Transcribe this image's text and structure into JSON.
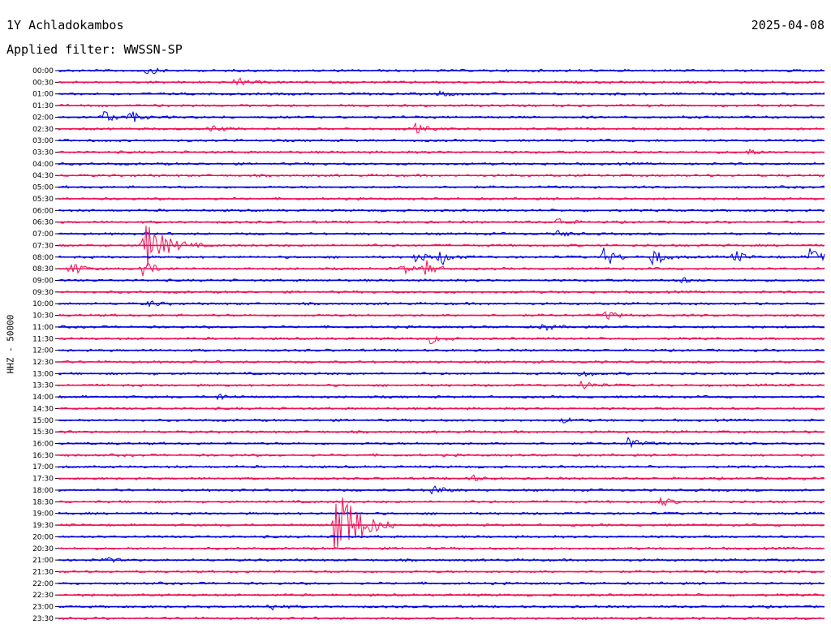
{
  "header": {
    "station": "1Y Achladokambos",
    "date": "2025-04-08",
    "filter": "Applied filter: WWSSN-SP"
  },
  "chart_data": {
    "type": "line",
    "plot_kind": "helicorder",
    "ylabel": "HHZ - 50000",
    "colors": [
      "#0000dd",
      "#ee1155"
    ],
    "rows": [
      "00:00",
      "00:30",
      "01:00",
      "01:30",
      "02:00",
      "02:30",
      "03:00",
      "03:30",
      "04:00",
      "04:30",
      "05:00",
      "05:30",
      "06:00",
      "06:30",
      "07:00",
      "07:30",
      "08:00",
      "08:30",
      "09:00",
      "09:30",
      "10:00",
      "10:30",
      "11:00",
      "11:30",
      "12:00",
      "12:30",
      "13:00",
      "13:30",
      "14:00",
      "14:30",
      "15:00",
      "15:30",
      "16:00",
      "16:30",
      "17:00",
      "17:30",
      "18:00",
      "18:30",
      "19:00",
      "19:30",
      "20:00",
      "20:30",
      "21:00",
      "21:30",
      "22:00",
      "22:30",
      "23:00",
      "23:30"
    ],
    "x_range_minutes": [
      0,
      30
    ],
    "events": [
      {
        "row": "00:00",
        "minute": 3.5,
        "amplitude": 5
      },
      {
        "row": "00:30",
        "minute": 7.0,
        "amplitude": 6
      },
      {
        "row": "01:00",
        "minute": 15.0,
        "amplitude": 4
      },
      {
        "row": "02:00",
        "minute": 1.8,
        "amplitude": 8
      },
      {
        "row": "02:00",
        "minute": 2.8,
        "amplitude": 8
      },
      {
        "row": "02:30",
        "minute": 6.0,
        "amplitude": 5
      },
      {
        "row": "02:30",
        "minute": 14.0,
        "amplitude": 6
      },
      {
        "row": "03:30",
        "minute": 27.0,
        "amplitude": 4
      },
      {
        "row": "06:30",
        "minute": 19.6,
        "amplitude": 6
      },
      {
        "row": "07:00",
        "minute": 19.6,
        "amplitude": 4
      },
      {
        "row": "07:30",
        "minute": 3.4,
        "amplitude": 30
      },
      {
        "row": "08:00",
        "minute": 14.0,
        "amplitude": 8
      },
      {
        "row": "08:00",
        "minute": 15.0,
        "amplitude": 10
      },
      {
        "row": "08:00",
        "minute": 21.4,
        "amplitude": 14
      },
      {
        "row": "08:00",
        "minute": 23.3,
        "amplitude": 12
      },
      {
        "row": "08:00",
        "minute": 26.5,
        "amplitude": 8
      },
      {
        "row": "08:00",
        "minute": 29.5,
        "amplitude": 16
      },
      {
        "row": "08:30",
        "minute": 0.5,
        "amplitude": 10
      },
      {
        "row": "08:30",
        "minute": 3.3,
        "amplitude": 14
      },
      {
        "row": "08:30",
        "minute": 13.5,
        "amplitude": 6
      },
      {
        "row": "08:30",
        "minute": 14.4,
        "amplitude": 10
      },
      {
        "row": "09:00",
        "minute": 24.3,
        "amplitude": 5
      },
      {
        "row": "10:00",
        "minute": 3.6,
        "amplitude": 4
      },
      {
        "row": "10:30",
        "minute": 21.5,
        "amplitude": 6
      },
      {
        "row": "11:00",
        "minute": 19.0,
        "amplitude": 5
      },
      {
        "row": "11:30",
        "minute": 14.6,
        "amplitude": 6
      },
      {
        "row": "13:00",
        "minute": 20.5,
        "amplitude": 4
      },
      {
        "row": "13:30",
        "minute": 20.5,
        "amplitude": 7
      },
      {
        "row": "14:00",
        "minute": 6.3,
        "amplitude": 4
      },
      {
        "row": "15:00",
        "minute": 19.8,
        "amplitude": 3
      },
      {
        "row": "16:00",
        "minute": 22.3,
        "amplitude": 8
      },
      {
        "row": "17:30",
        "minute": 16.1,
        "amplitude": 5
      },
      {
        "row": "18:00",
        "minute": 14.7,
        "amplitude": 8
      },
      {
        "row": "18:30",
        "minute": 23.6,
        "amplitude": 6
      },
      {
        "row": "19:30",
        "minute": 10.9,
        "amplitude": 60
      },
      {
        "row": "21:00",
        "minute": 1.8,
        "amplitude": 4
      },
      {
        "row": "23:00",
        "minute": 8.3,
        "amplitude": 5
      }
    ]
  }
}
